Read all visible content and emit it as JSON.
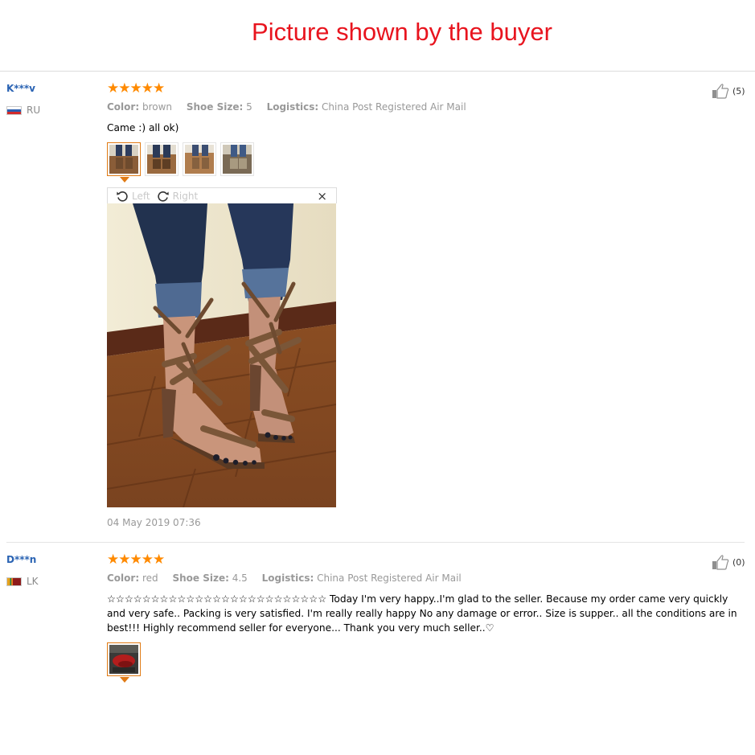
{
  "page": {
    "title": "Picture shown by the buyer"
  },
  "reviews": [
    {
      "user": "K***v",
      "country": "RU",
      "stars": "★★★★★",
      "color_label": "Color:",
      "color_value": "brown",
      "size_label": "Shoe Size:",
      "size_value": "5",
      "logistics_label": "Logistics:",
      "logistics_value": "China Post Registered Air Mail",
      "comment": "Came :) all ok)",
      "helpful_count": "(5)",
      "viewer": {
        "left_label": "Left",
        "right_label": "Right",
        "close_label": "×"
      },
      "date": "04 May 2019 07:36"
    },
    {
      "user": "D***n",
      "country": "LK",
      "stars": "★★★★★",
      "color_label": "Color:",
      "color_value": "red",
      "size_label": "Shoe Size:",
      "size_value": "4.5",
      "logistics_label": "Logistics:",
      "logistics_value": "China Post Registered Air Mail",
      "comment": "☆☆☆☆☆☆☆☆☆☆☆☆☆☆☆☆☆☆☆☆☆☆☆☆☆ Today I'm very happy..I'm glad to the seller. Because my order came very quickly and very safe.. Packing is very satisfied. I'm really really happy No any damage or error.. Size is supper.. all the conditions are in best!!! Highly recommend seller for everyone... Thank you very much seller..♡",
      "helpful_count": "(0)"
    }
  ],
  "colors": {
    "title": "#e8141e",
    "username": "#2a63b3",
    "stars": "#ff8a00",
    "active_thumb": "#e07a14",
    "meta": "#999999"
  },
  "icons": [
    "thumbs-up-icon",
    "rotate-left-icon",
    "rotate-right-icon",
    "close-icon",
    "flag-ru-icon",
    "flag-lk-icon"
  ]
}
